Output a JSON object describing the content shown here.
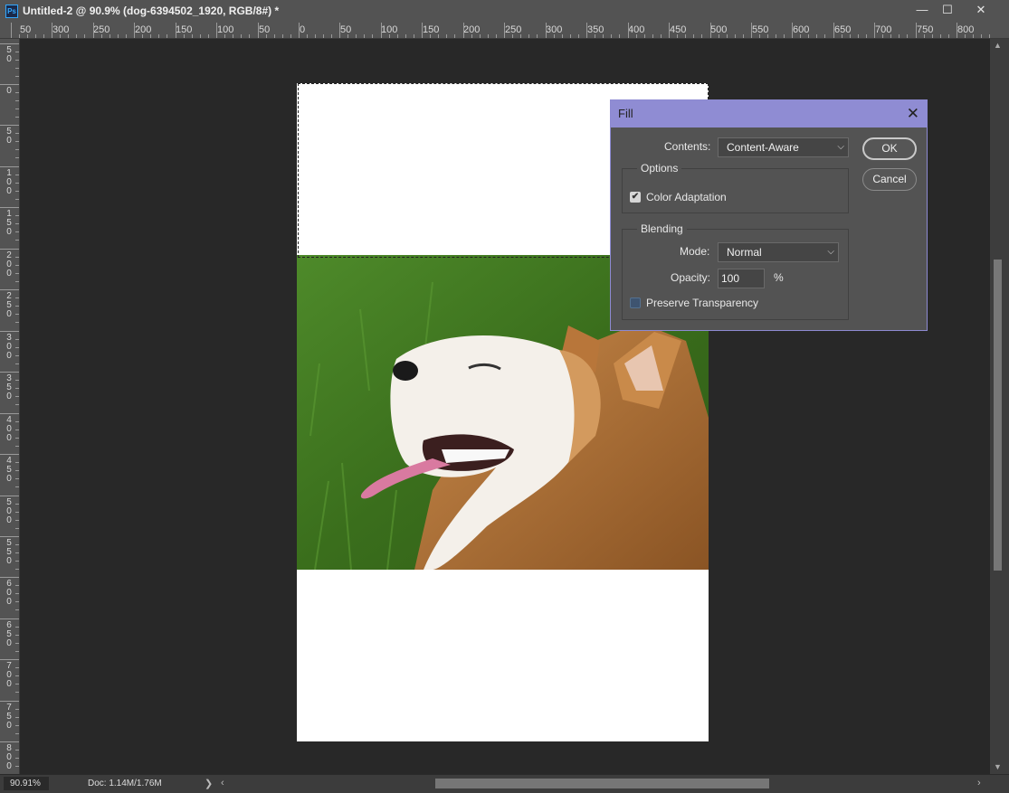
{
  "window": {
    "app_icon": "ps-icon",
    "app_icon_text": "Ps",
    "title": "Untitled-2 @ 90.9% (dog-6394502_1920, RGB/8#) *",
    "minimize": "—",
    "maximize": "☐",
    "close": "✕"
  },
  "ruler_top": [
    "50",
    "300",
    "250",
    "200",
    "150",
    "100",
    "50",
    "0",
    "50",
    "100",
    "150",
    "200",
    "250",
    "300",
    "350",
    "400",
    "450",
    "500",
    "550",
    "600",
    "650",
    "700",
    "750",
    "800"
  ],
  "ruler_left": [
    [
      "5",
      "0"
    ],
    [
      "0"
    ],
    [
      "5",
      "0"
    ],
    [
      "1",
      "0",
      "0"
    ],
    [
      "1",
      "5",
      "0"
    ],
    [
      "2",
      "0",
      "0"
    ],
    [
      "2",
      "5",
      "0"
    ],
    [
      "3",
      "0",
      "0"
    ],
    [
      "3",
      "5",
      "0"
    ],
    [
      "4",
      "0",
      "0"
    ],
    [
      "4",
      "5",
      "0"
    ],
    [
      "5",
      "0",
      "0"
    ],
    [
      "5",
      "5",
      "0"
    ],
    [
      "6",
      "0",
      "0"
    ],
    [
      "6",
      "5",
      "0"
    ],
    [
      "7",
      "0",
      "0"
    ],
    [
      "7",
      "5",
      "0"
    ],
    [
      "8",
      "0",
      "0"
    ]
  ],
  "status": {
    "zoom": "90.91%",
    "doc_info": "Doc: 1.14M/1.76M",
    "arrow": "❯",
    "left_arrow": "‹",
    "right_arrow": "›"
  },
  "fill_dialog": {
    "title": "Fill",
    "close": "✕",
    "contents_label": "Contents:",
    "contents_value": "Content-Aware",
    "options_title": "Options",
    "color_adaptation_label": "Color Adaptation",
    "color_adaptation_checked": true,
    "blending_title": "Blending",
    "mode_label": "Mode:",
    "mode_value": "Normal",
    "opacity_label": "Opacity:",
    "opacity_value": "100",
    "opacity_unit": "%",
    "preserve_label": "Preserve Transparency",
    "preserve_checked": false,
    "ok_label": "OK",
    "cancel_label": "Cancel",
    "chevron": "⌵",
    "check": "✔"
  },
  "colors": {
    "dialog_title_bg": "#8f8cd3",
    "workspace_bg": "#282828",
    "panel_bg": "#535353"
  }
}
